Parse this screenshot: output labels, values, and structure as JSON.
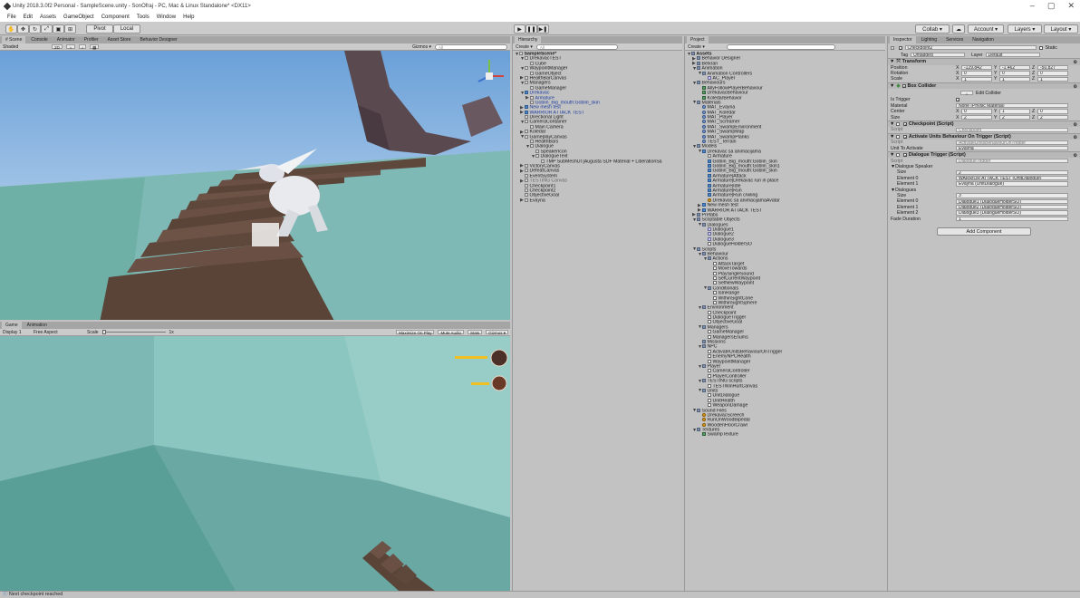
{
  "window": {
    "title": "Unity 2018.3.0f2 Personal - SampleScene.unity - SonOfraj - PC, Mac & Linux Standalone* <DX11>",
    "controls": [
      "–",
      "▢",
      "✕"
    ]
  },
  "menu": [
    "File",
    "Edit",
    "Assets",
    "GameObject",
    "Component",
    "Tools",
    "Window",
    "Help"
  ],
  "toolbar": {
    "pivot": "Pivot",
    "local": "Local",
    "collab": "Collab ▾",
    "account": "Account ▾",
    "layers": "Layers ▾",
    "layout": "Layout ▾"
  },
  "scene": {
    "tabs": [
      "# Scene",
      "Console",
      "Animator",
      "Profiler",
      "Asset Store",
      "Behavior Designer"
    ],
    "shading": "Shaded",
    "mode2d": "2D",
    "gizmos": "Gizmos ▾",
    "search_placeholder": "All"
  },
  "game": {
    "tabs": [
      "Game",
      "Animation"
    ],
    "display": "Display 1",
    "aspect": "Free Aspect",
    "scale_label": "Scale",
    "scale_value": "1x",
    "buttons": [
      "Maximize On Play",
      "Mute Audio",
      "Stats",
      "Gizmos ▾"
    ]
  },
  "hierarchy": {
    "tab": "Hierarchy",
    "create": "Create ▾",
    "search_placeholder": "All",
    "items": [
      {
        "label": "SampleScene*",
        "depth": 0,
        "style": "bold",
        "icon": "unity-scene-icon",
        "arrow": "▼"
      },
      {
        "label": "DrekavacTEST",
        "depth": 1,
        "icon": "go",
        "arrow": "▼"
      },
      {
        "label": "Cube",
        "depth": 2,
        "icon": "go",
        "arrow": ""
      },
      {
        "label": "WaypointManager",
        "depth": 1,
        "icon": "go",
        "arrow": "▼"
      },
      {
        "label": "GameObject",
        "depth": 2,
        "icon": "go",
        "arrow": ""
      },
      {
        "label": "HealthBarCanvas",
        "depth": 1,
        "icon": "go",
        "arrow": "▶"
      },
      {
        "label": "Managers",
        "depth": 1,
        "icon": "go",
        "arrow": "▼"
      },
      {
        "label": "GameManager",
        "depth": 2,
        "icon": "go",
        "arrow": ""
      },
      {
        "label": "Drekavac",
        "depth": 1,
        "icon": "prefab",
        "arrow": "▼",
        "style": "blue"
      },
      {
        "label": "Armature",
        "depth": 2,
        "icon": "go",
        "arrow": "▶",
        "style": "blue"
      },
      {
        "label": "Goblin_Big_mouth:Goblin_skin",
        "depth": 2,
        "icon": "go",
        "arrow": "",
        "style": "blue"
      },
      {
        "label": "New mesh test",
        "depth": 1,
        "icon": "prefab",
        "arrow": "▶",
        "style": "blue"
      },
      {
        "label": "WARRIOR ATTACK TEST",
        "depth": 1,
        "icon": "prefab",
        "arrow": "▶",
        "style": "blue"
      },
      {
        "label": "Directional Light",
        "depth": 1,
        "icon": "go",
        "arrow": ""
      },
      {
        "label": "CameraContainer",
        "depth": 1,
        "icon": "go",
        "arrow": "▼"
      },
      {
        "label": "Main Camera",
        "depth": 2,
        "icon": "go",
        "arrow": ""
      },
      {
        "label": "Koledar",
        "depth": 1,
        "icon": "go",
        "arrow": "▶"
      },
      {
        "label": "GameplayCanvas",
        "depth": 1,
        "icon": "go",
        "arrow": "▼"
      },
      {
        "label": "HealthBars",
        "depth": 2,
        "icon": "go",
        "arrow": ""
      },
      {
        "label": "Dialogue",
        "depth": 2,
        "icon": "go",
        "arrow": "▼"
      },
      {
        "label": "SpeakerIcon",
        "depth": 3,
        "icon": "go",
        "arrow": ""
      },
      {
        "label": "DialogueText",
        "depth": 3,
        "icon": "go",
        "arrow": "▼"
      },
      {
        "label": "TMP SubMeshUI [Augusta SDF Material + LiberationSa",
        "depth": 4,
        "icon": "go",
        "arrow": ""
      },
      {
        "label": "VictoryCanvas",
        "depth": 1,
        "icon": "go",
        "arrow": "▶"
      },
      {
        "label": "DefeatCanvas",
        "depth": 1,
        "icon": "go",
        "arrow": "▶"
      },
      {
        "label": "EventSystem",
        "depth": 1,
        "icon": "go",
        "arrow": ""
      },
      {
        "label": "TESTING Canvas",
        "depth": 1,
        "icon": "go",
        "arrow": "▶",
        "style": "grey"
      },
      {
        "label": "Checkpoint1",
        "depth": 1,
        "icon": "go",
        "arrow": ""
      },
      {
        "label": "Checkpoint2",
        "depth": 1,
        "icon": "go",
        "arrow": ""
      },
      {
        "label": "ObjectiveGoal",
        "depth": 1,
        "icon": "go",
        "arrow": ""
      },
      {
        "label": "Evayna",
        "depth": 1,
        "icon": "go",
        "arrow": "▶"
      }
    ]
  },
  "project": {
    "tab": "Project",
    "create": "Create ▾",
    "search_placeholder": "",
    "items": [
      {
        "label": "Assets",
        "depth": 0,
        "icon": "folder",
        "arrow": "▼",
        "style": "bold"
      },
      {
        "label": "Behavior Designer",
        "depth": 1,
        "icon": "folder",
        "arrow": "▶"
      },
      {
        "label": "Belxran",
        "depth": 1,
        "icon": "folder",
        "arrow": "▶"
      },
      {
        "label": "Animation",
        "depth": 1,
        "icon": "folder",
        "arrow": "▼"
      },
      {
        "label": "Animation Controllers",
        "depth": 2,
        "icon": "folder",
        "arrow": "▼"
      },
      {
        "label": "AC_Player",
        "depth": 3,
        "icon": "so",
        "arrow": ""
      },
      {
        "label": "Behaviours",
        "depth": 1,
        "icon": "folder",
        "arrow": "▼"
      },
      {
        "label": "AllyFollowPlayerBehaviour",
        "depth": 2,
        "icon": "tex",
        "arrow": ""
      },
      {
        "label": "DrekavacBehaviour",
        "depth": 2,
        "icon": "tex",
        "arrow": ""
      },
      {
        "label": "KoledarBehavior",
        "depth": 2,
        "icon": "tex",
        "arrow": ""
      },
      {
        "label": "Materials",
        "depth": 1,
        "icon": "folder",
        "arrow": "▼"
      },
      {
        "label": "MAT_Evayna",
        "depth": 2,
        "icon": "mat",
        "arrow": ""
      },
      {
        "label": "MAT_Koledar",
        "depth": 2,
        "icon": "mat",
        "arrow": ""
      },
      {
        "label": "MAT_Player",
        "depth": 2,
        "icon": "mat",
        "arrow": ""
      },
      {
        "label": "MAT_Screamer",
        "depth": 2,
        "icon": "mat",
        "arrow": ""
      },
      {
        "label": "MAT_SwampEnvironment",
        "depth": 2,
        "icon": "mat",
        "arrow": ""
      },
      {
        "label": "MAT_SwampMap",
        "depth": 2,
        "icon": "mat",
        "arrow": ""
      },
      {
        "label": "MAT_SwampPlanks",
        "depth": 2,
        "icon": "mat",
        "arrow": ""
      },
      {
        "label": "TEST_Terrain",
        "depth": 2,
        "icon": "mat",
        "arrow": ""
      },
      {
        "label": "Models",
        "depth": 1,
        "icon": "folder",
        "arrow": "▼"
      },
      {
        "label": "Drekavac sa animacijama",
        "depth": 2,
        "icon": "prefab",
        "arrow": "▼"
      },
      {
        "label": "Armature",
        "depth": 3,
        "icon": "go",
        "arrow": ""
      },
      {
        "label": "Goblin_Big_mouth:Goblin_skin",
        "depth": 3,
        "icon": "prefab",
        "arrow": ""
      },
      {
        "label": "Goblin_Big_mouth:Goblin_skin1",
        "depth": 3,
        "icon": "prefab",
        "arrow": ""
      },
      {
        "label": "Goblin_Big_mouth:Goblin_skin",
        "depth": 3,
        "icon": "prefab",
        "arrow": ""
      },
      {
        "label": "Armature|Attack",
        "depth": 3,
        "icon": "prefab",
        "arrow": ""
      },
      {
        "label": "Armature|Drekavac run in place",
        "depth": 3,
        "icon": "prefab",
        "arrow": ""
      },
      {
        "label": "Armature|Idle",
        "depth": 3,
        "icon": "prefab",
        "arrow": ""
      },
      {
        "label": "Armature|Run",
        "depth": 3,
        "icon": "prefab",
        "arrow": ""
      },
      {
        "label": "Armature|Run crwling",
        "depth": 3,
        "icon": "prefab",
        "arrow": ""
      },
      {
        "label": "Drekavac sa animacijamaAvatar",
        "depth": 3,
        "icon": "audio",
        "arrow": ""
      },
      {
        "label": "New mesh test",
        "depth": 2,
        "icon": "prefab",
        "arrow": "▶"
      },
      {
        "label": "WARRIOR ATTACK TEST",
        "depth": 2,
        "icon": "prefab",
        "arrow": "▶"
      },
      {
        "label": "Prefabs",
        "depth": 1,
        "icon": "folder",
        "arrow": "▶"
      },
      {
        "label": "Scriptable Objects",
        "depth": 1,
        "icon": "folder",
        "arrow": "▼"
      },
      {
        "label": "Dialogues",
        "depth": 2,
        "icon": "folder",
        "arrow": "▼"
      },
      {
        "label": "Dialogue1",
        "depth": 3,
        "icon": "so",
        "arrow": ""
      },
      {
        "label": "Dialogue2",
        "depth": 3,
        "icon": "so",
        "arrow": ""
      },
      {
        "label": "Dialogue3",
        "depth": 3,
        "icon": "so",
        "arrow": ""
      },
      {
        "label": "DialogueHolderSO",
        "depth": 3,
        "icon": "script",
        "arrow": ""
      },
      {
        "label": "Scripts",
        "depth": 1,
        "icon": "folder",
        "arrow": "▼"
      },
      {
        "label": "Behaviour",
        "depth": 2,
        "icon": "folder",
        "arrow": "▼"
      },
      {
        "label": "Actions",
        "depth": 3,
        "icon": "folder",
        "arrow": "▼"
      },
      {
        "label": "AttackTarget",
        "depth": 4,
        "icon": "script",
        "arrow": ""
      },
      {
        "label": "MoveTowards",
        "depth": 4,
        "icon": "script",
        "arrow": ""
      },
      {
        "label": "PlaySingleSound",
        "depth": 4,
        "icon": "script",
        "arrow": ""
      },
      {
        "label": "SetCurrentWaypoint",
        "depth": 4,
        "icon": "script",
        "arrow": ""
      },
      {
        "label": "SetNewWaypoint",
        "depth": 4,
        "icon": "script",
        "arrow": ""
      },
      {
        "label": "Conditionals",
        "depth": 3,
        "icon": "folder",
        "arrow": "▼"
      },
      {
        "label": "IsInRange",
        "depth": 4,
        "icon": "script",
        "arrow": ""
      },
      {
        "label": "WithinSightCone",
        "depth": 4,
        "icon": "script",
        "arrow": ""
      },
      {
        "label": "WithinSightSphere",
        "depth": 4,
        "icon": "script",
        "arrow": ""
      },
      {
        "label": "Environment",
        "depth": 2,
        "icon": "folder",
        "arrow": "▼"
      },
      {
        "label": "Checkpoint",
        "depth": 3,
        "icon": "script",
        "arrow": ""
      },
      {
        "label": "DialogueTrigger",
        "depth": 3,
        "icon": "script",
        "arrow": ""
      },
      {
        "label": "ObjectiveGoal",
        "depth": 3,
        "icon": "script",
        "arrow": ""
      },
      {
        "label": "Managers",
        "depth": 2,
        "icon": "folder",
        "arrow": "▼"
      },
      {
        "label": "GameManager",
        "depth": 3,
        "icon": "script",
        "arrow": ""
      },
      {
        "label": "ManagersEnums",
        "depth": 3,
        "icon": "script",
        "arrow": ""
      },
      {
        "label": "Missions",
        "depth": 2,
        "icon": "folder",
        "arrow": ""
      },
      {
        "label": "NPC",
        "depth": 2,
        "icon": "folder",
        "arrow": "▼"
      },
      {
        "label": "ActivateUnitsBehaviourOnTrigger",
        "depth": 3,
        "icon": "script",
        "arrow": ""
      },
      {
        "label": "EnemyNPCHealth",
        "depth": 3,
        "icon": "script",
        "arrow": ""
      },
      {
        "label": "WaypointManager",
        "depth": 3,
        "icon": "script",
        "arrow": ""
      },
      {
        "label": "Player",
        "depth": 2,
        "icon": "folder",
        "arrow": "▼"
      },
      {
        "label": "CameraController",
        "depth": 3,
        "icon": "script",
        "arrow": ""
      },
      {
        "label": "PlayerController",
        "depth": 3,
        "icon": "script",
        "arrow": ""
      },
      {
        "label": "TESTING scripts",
        "depth": 2,
        "icon": "folder",
        "arrow": "▼"
      },
      {
        "label": "TESTWinHurtCanvas",
        "depth": 3,
        "icon": "script",
        "arrow": ""
      },
      {
        "label": "Units",
        "depth": 2,
        "icon": "folder",
        "arrow": "▼"
      },
      {
        "label": "UnitDialogue",
        "depth": 3,
        "icon": "script",
        "arrow": ""
      },
      {
        "label": "UnitHealth",
        "depth": 3,
        "icon": "script",
        "arrow": ""
      },
      {
        "label": "WeaponDamage",
        "depth": 3,
        "icon": "script",
        "arrow": ""
      },
      {
        "label": "Sound Files",
        "depth": 1,
        "icon": "folder",
        "arrow": "▼"
      },
      {
        "label": "DrekavacScreech",
        "depth": 2,
        "icon": "audio",
        "arrow": ""
      },
      {
        "label": "RunOnWoodBipedal",
        "depth": 2,
        "icon": "audio",
        "arrow": ""
      },
      {
        "label": "WoodenFloorCrawl",
        "depth": 2,
        "icon": "audio",
        "arrow": ""
      },
      {
        "label": "Textures",
        "depth": 1,
        "icon": "folder",
        "arrow": "▼"
      },
      {
        "label": "SwampTexture",
        "depth": 2,
        "icon": "tex",
        "arrow": ""
      }
    ]
  },
  "inspector": {
    "tabs": [
      "Inspector",
      "Lighting",
      "Services",
      "Navigation"
    ],
    "object_name": "Checkpoint2",
    "static_label": "Static",
    "tag_label": "Tag",
    "tag_value": "Untagged",
    "layer_label": "Layer",
    "layer_value": "Default",
    "transform": {
      "title": "Transform",
      "rows": [
        {
          "label": "Position",
          "x": "-129.842",
          "y": "-1.462",
          "z": "-50.827"
        },
        {
          "label": "Rotation",
          "x": "0",
          "y": "0",
          "z": "0"
        },
        {
          "label": "Scale",
          "x": "1",
          "y": "1",
          "z": "1"
        }
      ]
    },
    "box_collider": {
      "title": "Box Collider",
      "edit_label": "Edit Collider",
      "is_trigger_label": "Is Trigger",
      "material_label": "Material",
      "material_value": "None (Physic Material)",
      "center_label": "Center",
      "center": {
        "x": "0",
        "y": "1",
        "z": "0"
      },
      "size_label": "Size",
      "size": {
        "x": "2",
        "y": "2",
        "z": "2"
      }
    },
    "checkpoint": {
      "title": "Checkpoint (Script)",
      "script_label": "Script",
      "script_value": "Checkpoint"
    },
    "activate": {
      "title": "Activate Units Behaviour On Trigger (Script)",
      "script_label": "Script",
      "script_value": "ActivateUnitsBehaviourOnTrigger",
      "unit_label": "Unit To Activate",
      "unit_value": "Evayna"
    },
    "dialogue_trigger": {
      "title": "Dialogue Trigger (Script)",
      "script_label": "Script",
      "script_value": "DialogueTrigger",
      "speaker_header": "Dialogue Speaker",
      "speaker_size_label": "Size",
      "speaker_size": "2",
      "speakers": [
        {
          "label": "Element 0",
          "value": "WARRIOR ATTACK TEST (UnitDialogue)"
        },
        {
          "label": "Element 1",
          "value": "Evayna (UnitDialogue)"
        }
      ],
      "dialogues_header": "Dialogues",
      "dialogues_size_label": "Size",
      "dialogues_size": "3",
      "dialogues": [
        {
          "label": "Element 0",
          "value": "Dialogue1 (DialogueHolderSO)"
        },
        {
          "label": "Element 1",
          "value": "Dialogue2 (DialogueHolderSO)"
        },
        {
          "label": "Element 2",
          "value": "Dialogue3 (DialogueHolderSO)"
        }
      ],
      "fade_label": "Fade Duration",
      "fade_value": "1"
    },
    "add_component": "Add Component"
  },
  "status": {
    "message": "Next checkpoint reached"
  },
  "colors": {
    "sky": "#78a8d8",
    "ground": "#7eb8b4",
    "game_bg": "#6aa8a4",
    "plank": "#5a4438",
    "health": "#f0c020"
  }
}
